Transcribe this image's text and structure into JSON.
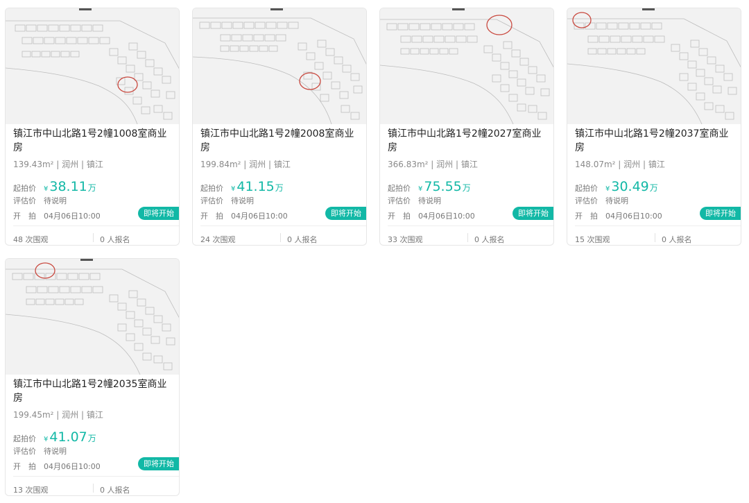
{
  "cards": [
    {
      "title": "镇江市中山北路1号2幢1008室商业房",
      "meta": "139.43m² | 润州 | 镇江",
      "price_label": "起拍价",
      "currency": "¥",
      "price": "38.11",
      "unit": "万",
      "eval_label": "评估价",
      "eval_value": "待说明",
      "time_label": "开　拍",
      "time_value": "04月06日10:00",
      "status": "即将开始",
      "views": "48 次围观",
      "signups": "0 人报名"
    },
    {
      "title": "镇江市中山北路1号2幢2008室商业房",
      "meta": "199.84m² | 润州 | 镇江",
      "price_label": "起拍价",
      "currency": "¥",
      "price": "41.15",
      "unit": "万",
      "eval_label": "评估价",
      "eval_value": "待说明",
      "time_label": "开　拍",
      "time_value": "04月06日10:00",
      "status": "即将开始",
      "views": "24 次围观",
      "signups": "0 人报名"
    },
    {
      "title": "镇江市中山北路1号2幢2027室商业房",
      "meta": "366.83m² | 润州 | 镇江",
      "price_label": "起拍价",
      "currency": "¥",
      "price": "75.55",
      "unit": "万",
      "eval_label": "评估价",
      "eval_value": "待说明",
      "time_label": "开　拍",
      "time_value": "04月06日10:00",
      "status": "即将开始",
      "views": "33 次围观",
      "signups": "0 人报名"
    },
    {
      "title": "镇江市中山北路1号2幢2037室商业房",
      "meta": "148.07m² | 润州 | 镇江",
      "price_label": "起拍价",
      "currency": "¥",
      "price": "30.49",
      "unit": "万",
      "eval_label": "评估价",
      "eval_value": "待说明",
      "time_label": "开　拍",
      "time_value": "04月06日10:00",
      "status": "即将开始",
      "views": "15 次围观",
      "signups": "0 人报名"
    },
    {
      "title": "镇江市中山北路1号2幢2035室商业房",
      "meta": "199.45m² | 润州 | 镇江",
      "price_label": "起拍价",
      "currency": "¥",
      "price": "41.07",
      "unit": "万",
      "eval_label": "评估价",
      "eval_value": "待说明",
      "time_label": "开　拍",
      "time_value": "04月06日10:00",
      "status": "即将开始",
      "views": "13 次围观",
      "signups": "0 人报名"
    }
  ],
  "colors": {
    "accent": "#12b8a6",
    "marker": "#c9483e",
    "plan_line": "#b9b9b9",
    "thumb_bg": "#f2f2f2"
  }
}
